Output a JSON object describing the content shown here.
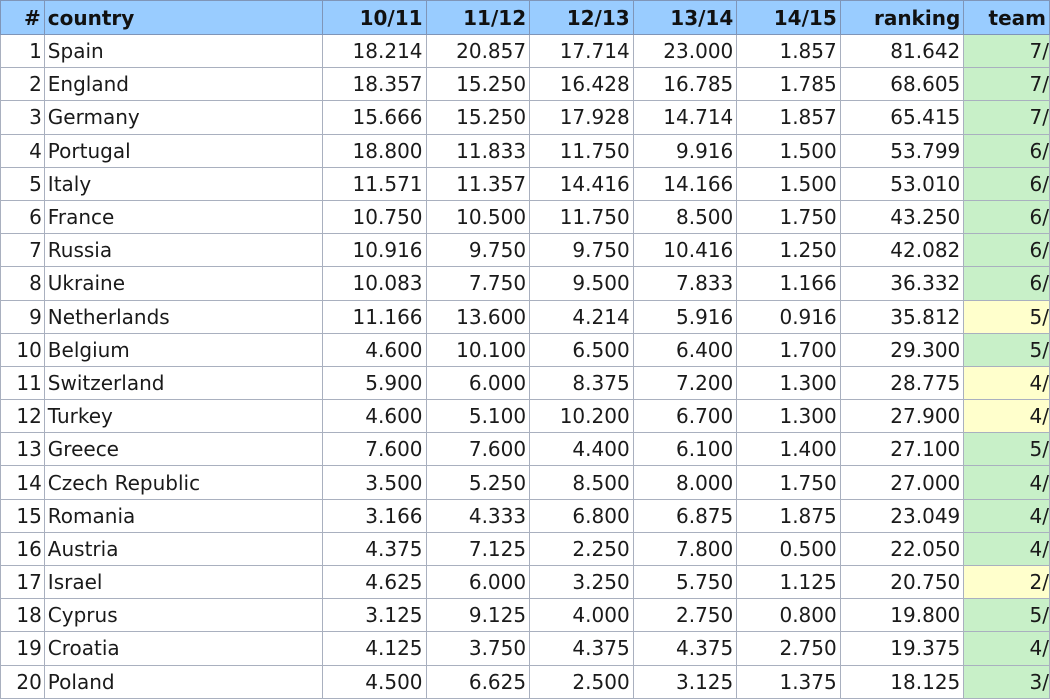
{
  "columns": {
    "rank": "#",
    "country": "country",
    "s1011": "10/11",
    "s1112": "11/12",
    "s1213": "12/13",
    "s1314": "13/14",
    "s1415": "14/15",
    "ranking": "ranking",
    "teams": "team"
  },
  "rows": [
    {
      "rank": "1",
      "country": "Spain",
      "s1011": "18.214",
      "s1112": "20.857",
      "s1213": "17.714",
      "s1314": "23.000",
      "s1415": "1.857",
      "ranking": "81.642",
      "teams": "7/",
      "teams_color": "#c8f0c8"
    },
    {
      "rank": "2",
      "country": "England",
      "s1011": "18.357",
      "s1112": "15.250",
      "s1213": "16.428",
      "s1314": "16.785",
      "s1415": "1.785",
      "ranking": "68.605",
      "teams": "7/",
      "teams_color": "#c8f0c8"
    },
    {
      "rank": "3",
      "country": "Germany",
      "s1011": "15.666",
      "s1112": "15.250",
      "s1213": "17.928",
      "s1314": "14.714",
      "s1415": "1.857",
      "ranking": "65.415",
      "teams": "7/",
      "teams_color": "#c8f0c8"
    },
    {
      "rank": "4",
      "country": "Portugal",
      "s1011": "18.800",
      "s1112": "11.833",
      "s1213": "11.750",
      "s1314": "9.916",
      "s1415": "1.500",
      "ranking": "53.799",
      "teams": "6/",
      "teams_color": "#c8f0c8"
    },
    {
      "rank": "5",
      "country": "Italy",
      "s1011": "11.571",
      "s1112": "11.357",
      "s1213": "14.416",
      "s1314": "14.166",
      "s1415": "1.500",
      "ranking": "53.010",
      "teams": "6/",
      "teams_color": "#c8f0c8"
    },
    {
      "rank": "6",
      "country": "France",
      "s1011": "10.750",
      "s1112": "10.500",
      "s1213": "11.750",
      "s1314": "8.500",
      "s1415": "1.750",
      "ranking": "43.250",
      "teams": "6/",
      "teams_color": "#c8f0c8"
    },
    {
      "rank": "7",
      "country": "Russia",
      "s1011": "10.916",
      "s1112": "9.750",
      "s1213": "9.750",
      "s1314": "10.416",
      "s1415": "1.250",
      "ranking": "42.082",
      "teams": "6/",
      "teams_color": "#c8f0c8"
    },
    {
      "rank": "8",
      "country": "Ukraine",
      "s1011": "10.083",
      "s1112": "7.750",
      "s1213": "9.500",
      "s1314": "7.833",
      "s1415": "1.166",
      "ranking": "36.332",
      "teams": "6/",
      "teams_color": "#c8f0c8"
    },
    {
      "rank": "9",
      "country": "Netherlands",
      "s1011": "11.166",
      "s1112": "13.600",
      "s1213": "4.214",
      "s1314": "5.916",
      "s1415": "0.916",
      "ranking": "35.812",
      "teams": "5/",
      "teams_color": "#ffffcc"
    },
    {
      "rank": "10",
      "country": "Belgium",
      "s1011": "4.600",
      "s1112": "10.100",
      "s1213": "6.500",
      "s1314": "6.400",
      "s1415": "1.700",
      "ranking": "29.300",
      "teams": "5/",
      "teams_color": "#c8f0c8"
    },
    {
      "rank": "11",
      "country": "Switzerland",
      "s1011": "5.900",
      "s1112": "6.000",
      "s1213": "8.375",
      "s1314": "7.200",
      "s1415": "1.300",
      "ranking": "28.775",
      "teams": "4/",
      "teams_color": "#ffffcc"
    },
    {
      "rank": "12",
      "country": "Turkey",
      "s1011": "4.600",
      "s1112": "5.100",
      "s1213": "10.200",
      "s1314": "6.700",
      "s1415": "1.300",
      "ranking": "27.900",
      "teams": "4/",
      "teams_color": "#ffffcc"
    },
    {
      "rank": "13",
      "country": "Greece",
      "s1011": "7.600",
      "s1112": "7.600",
      "s1213": "4.400",
      "s1314": "6.100",
      "s1415": "1.400",
      "ranking": "27.100",
      "teams": "5/",
      "teams_color": "#c8f0c8"
    },
    {
      "rank": "14",
      "country": "Czech Republic",
      "s1011": "3.500",
      "s1112": "5.250",
      "s1213": "8.500",
      "s1314": "8.000",
      "s1415": "1.750",
      "ranking": "27.000",
      "teams": "4/",
      "teams_color": "#c8f0c8"
    },
    {
      "rank": "15",
      "country": "Romania",
      "s1011": "3.166",
      "s1112": "4.333",
      "s1213": "6.800",
      "s1314": "6.875",
      "s1415": "1.875",
      "ranking": "23.049",
      "teams": "4/",
      "teams_color": "#c8f0c8"
    },
    {
      "rank": "16",
      "country": "Austria",
      "s1011": "4.375",
      "s1112": "7.125",
      "s1213": "2.250",
      "s1314": "7.800",
      "s1415": "0.500",
      "ranking": "22.050",
      "teams": "4/",
      "teams_color": "#c8f0c8"
    },
    {
      "rank": "17",
      "country": "Israel",
      "s1011": "4.625",
      "s1112": "6.000",
      "s1213": "3.250",
      "s1314": "5.750",
      "s1415": "1.125",
      "ranking": "20.750",
      "teams": "2/",
      "teams_color": "#ffffcc"
    },
    {
      "rank": "18",
      "country": "Cyprus",
      "s1011": "3.125",
      "s1112": "9.125",
      "s1213": "4.000",
      "s1314": "2.750",
      "s1415": "0.800",
      "ranking": "19.800",
      "teams": "5/",
      "teams_color": "#c8f0c8"
    },
    {
      "rank": "19",
      "country": "Croatia",
      "s1011": "4.125",
      "s1112": "3.750",
      "s1213": "4.375",
      "s1314": "4.375",
      "s1415": "2.750",
      "ranking": "19.375",
      "teams": "4/",
      "teams_color": "#c8f0c8"
    },
    {
      "rank": "20",
      "country": "Poland",
      "s1011": "4.500",
      "s1112": "6.625",
      "s1213": "2.500",
      "s1314": "3.125",
      "s1415": "1.375",
      "ranking": "18.125",
      "teams": "3/",
      "teams_color": "#c8f0c8"
    }
  ]
}
